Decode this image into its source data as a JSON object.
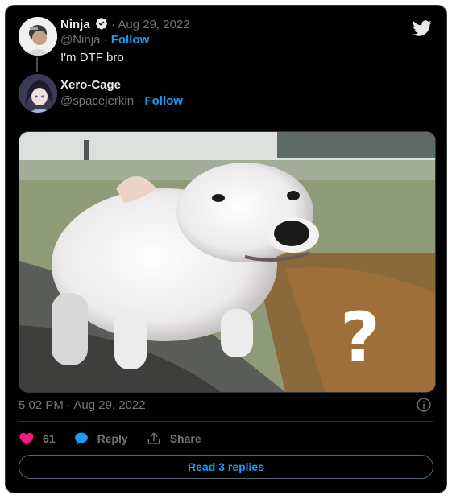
{
  "colors": {
    "accent": "#1d9bf0",
    "like": "#f91880",
    "background": "#000000",
    "muted": "#71767b",
    "text": "#e7e9ea"
  },
  "tweet": {
    "author_name": "Ninja",
    "verified_icon": "verified-badge-icon",
    "date_separator": "·",
    "date": "Aug 29, 2022",
    "handle": "@Ninja",
    "follow_label": "Follow",
    "text": "I'm DTF bro"
  },
  "reply": {
    "author_name": "Xero-Cage",
    "handle": "@spacejerkin",
    "follow_label": "Follow",
    "media_overlay_text": "?",
    "timestamp": "5:02 PM · Aug 29, 2022",
    "likes": "61",
    "reply_label": "Reply",
    "share_label": "Share",
    "read_replies_label": "Read 3 replies"
  }
}
